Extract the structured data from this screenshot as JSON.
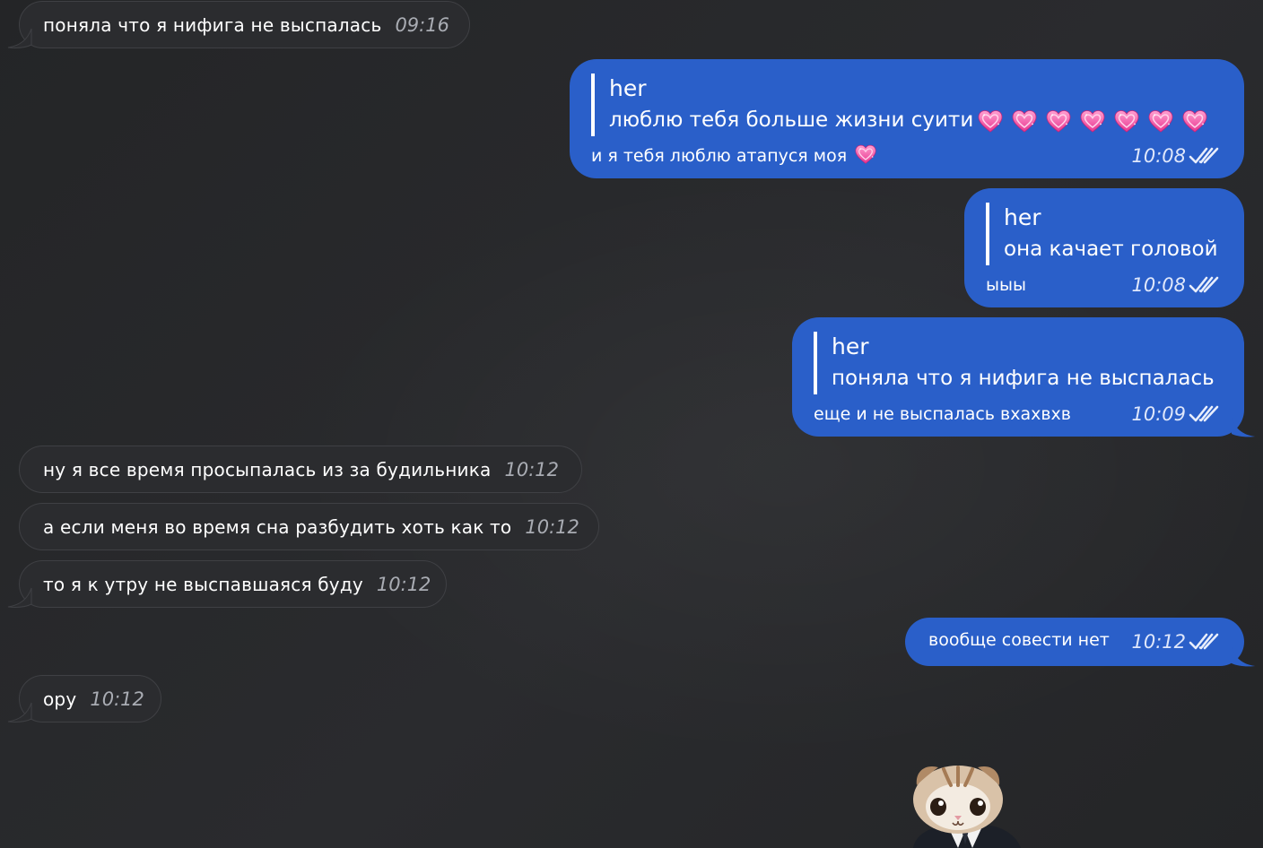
{
  "messages": {
    "m1": {
      "text": "поняла что я нифига не выспалась",
      "time": "09:16"
    },
    "o1": {
      "quote_name": "her",
      "quote_text": "люблю тебя больше жизни суити",
      "text": "и я тебя люблю атапуся моя",
      "time": "10:08"
    },
    "o2": {
      "quote_name": "her",
      "quote_text": "она качает головой",
      "text": "ыыы",
      "time": "10:08"
    },
    "o3": {
      "quote_name": "her",
      "quote_text": "поняла что я нифига не выспалась",
      "text": "еще и не выспалась вхахвхв",
      "time": "10:09"
    },
    "m2": {
      "text": "ну я все время просыпалась из за будильника",
      "time": "10:12"
    },
    "m3": {
      "text": "а если меня во время сна разбудить хоть как то",
      "time": "10:12"
    },
    "m4": {
      "text": "то я к утру не выспавшаяся буду",
      "time": "10:12"
    },
    "o4": {
      "text": "вообще совести нет",
      "time": "10:12"
    },
    "m5": {
      "text": "ору",
      "time": "10:12"
    }
  },
  "icons": {
    "heart": "sparkling-heart-emoji",
    "read_status": "double-check-icon",
    "sticker": "kitten-sticker"
  },
  "colors": {
    "background": "#262729",
    "incoming_bubble": "#2b2c2f",
    "outgoing_bubble": "#2a5fc9"
  }
}
